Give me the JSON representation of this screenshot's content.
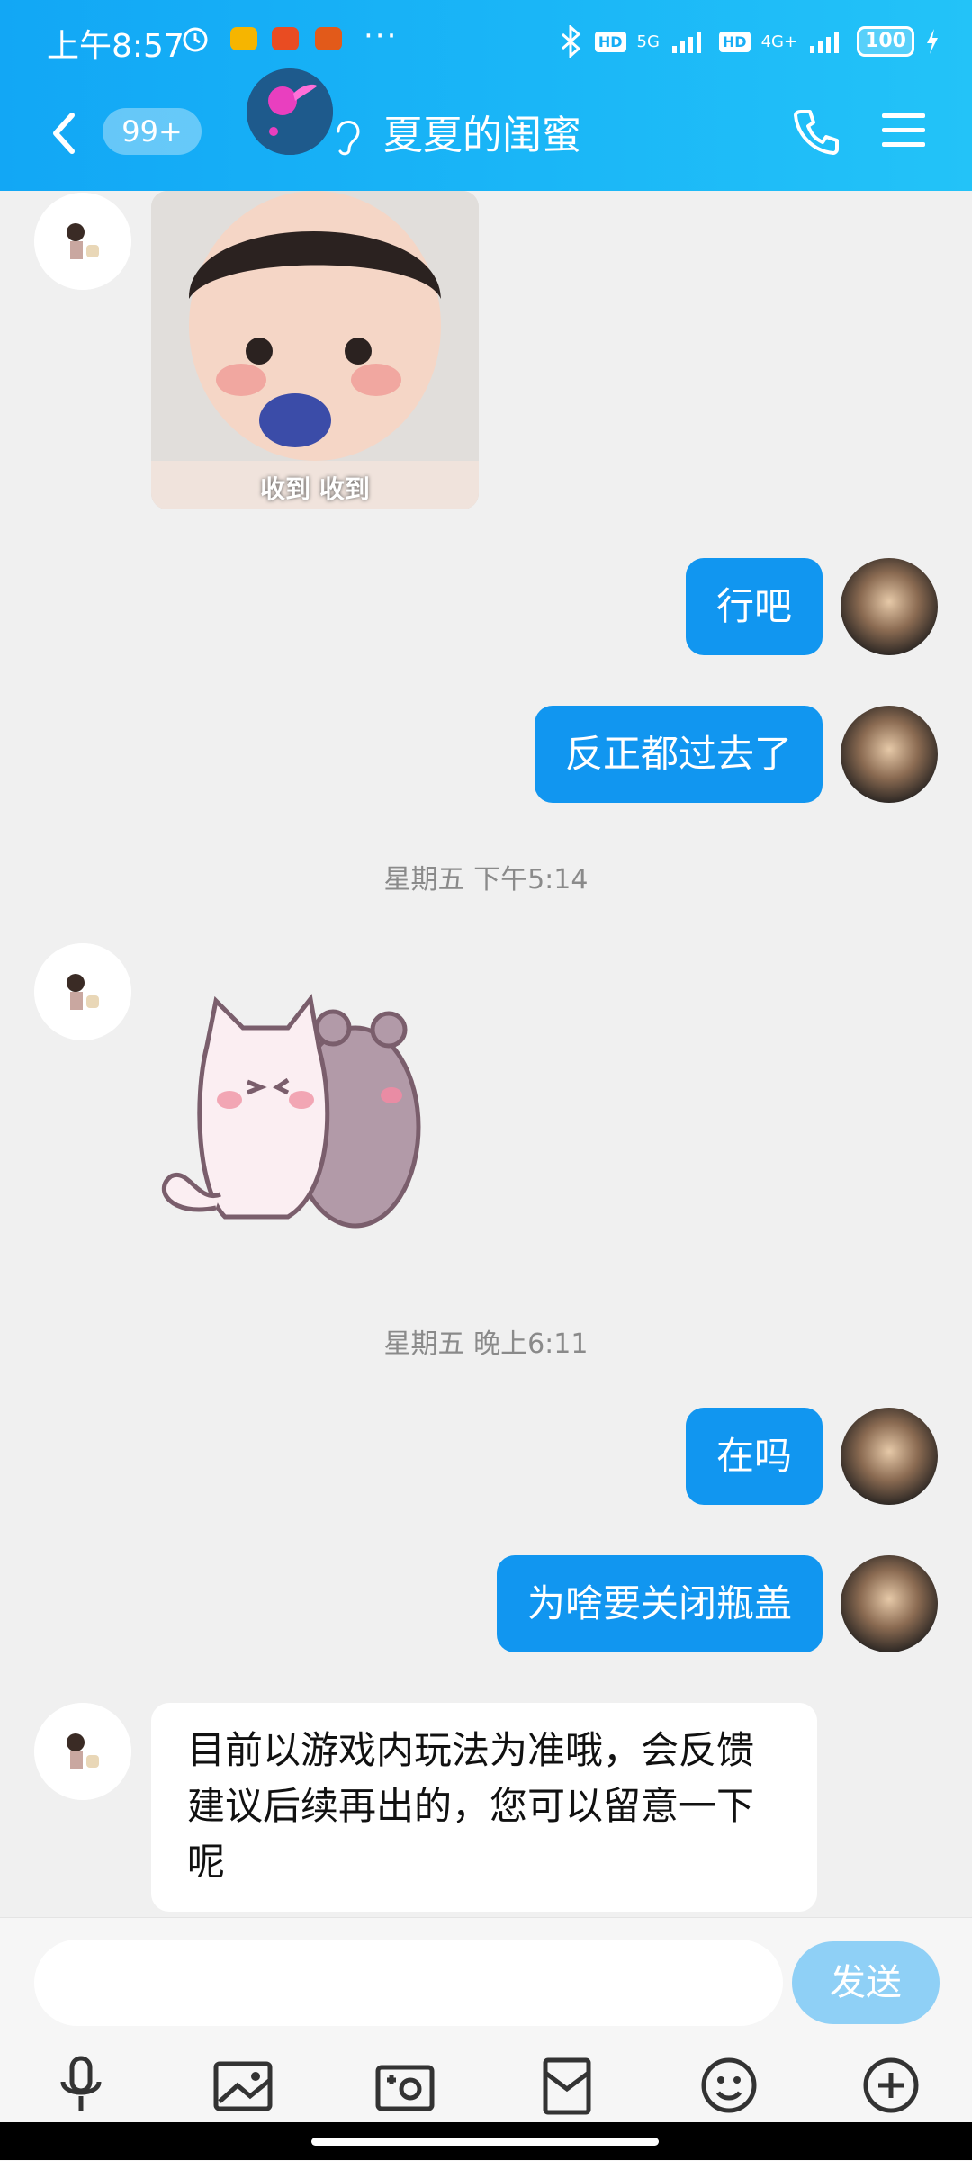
{
  "status_bar": {
    "time": "上午8:57",
    "dots": "···",
    "net1": "5G",
    "net2": "4G+",
    "hd": "HD",
    "battery": "100"
  },
  "header": {
    "unread_badge": "99+",
    "title": "夏夏的闺蜜"
  },
  "messages": {
    "m1_sticker_caption": "收到 收到",
    "m2": "行吧",
    "m3": "反正都过去了",
    "t1": "星期五 下午5:14",
    "t2": "星期五 晚上6:11",
    "m5": "在吗",
    "m6": "为啥要关闭瓶盖",
    "m7": "目前以游戏内玩法为准哦，会反馈建议后续再出的，您可以留意一下呢"
  },
  "input": {
    "value": "",
    "placeholder": "",
    "send_label": "发送"
  },
  "toolbar": {
    "items": [
      "voice-icon",
      "image-icon",
      "camera-icon",
      "red-packet-icon",
      "emoji-icon",
      "plus-icon"
    ]
  },
  "colors": {
    "header": "#16adf6",
    "bubble_self": "#1196f0",
    "bubble_other": "#ffffff",
    "send_disabled": "#8fd0f6"
  }
}
